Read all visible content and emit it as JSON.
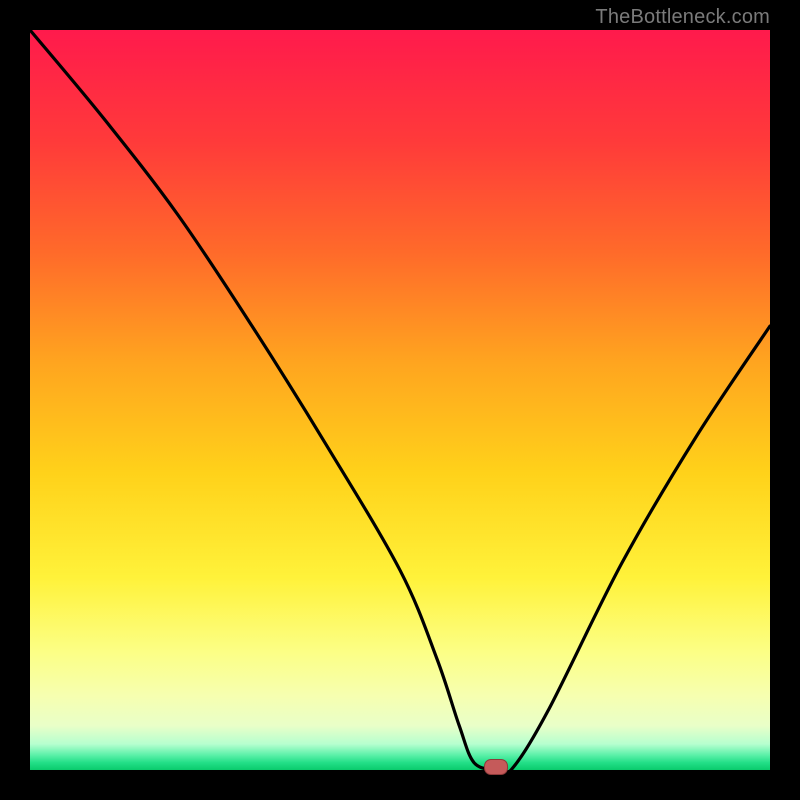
{
  "watermark": {
    "text": "TheBottleneck.com"
  },
  "colors": {
    "frame_bg": "#000000",
    "gradient_top": "#ff1a4c",
    "gradient_bottom": "#0acb6c",
    "curve_stroke": "#000000",
    "marker_fill": "#c55a5a",
    "marker_border": "#8e3a3a"
  },
  "chart_data": {
    "type": "line",
    "title": "",
    "xlabel": "",
    "ylabel": "",
    "xlim": [
      0,
      100
    ],
    "ylim": [
      0,
      100
    ],
    "grid": false,
    "legend": null,
    "annotations": [],
    "series": [
      {
        "name": "bottleneck-curve",
        "x": [
          0,
          10,
          20,
          30,
          40,
          50,
          55,
          58,
          60,
          63,
          65,
          70,
          80,
          90,
          100
        ],
        "y": [
          100,
          88,
          75,
          60,
          44,
          27,
          15,
          6,
          1,
          0,
          0,
          8,
          28,
          45,
          60
        ]
      }
    ],
    "marker": {
      "x": 63,
      "y": 0
    }
  }
}
